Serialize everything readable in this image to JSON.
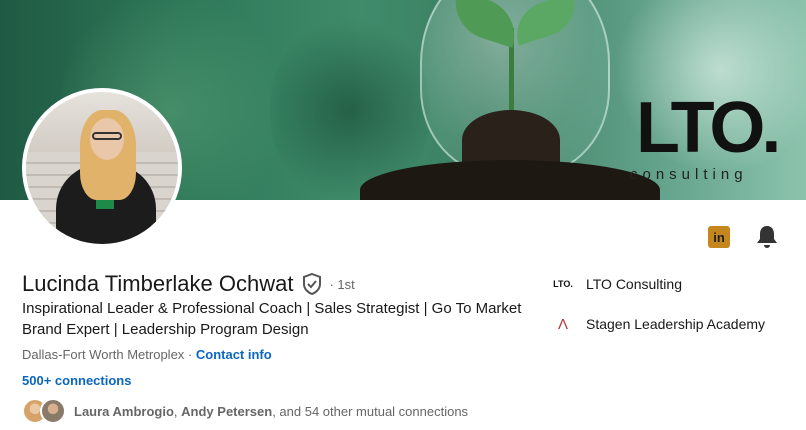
{
  "banner": {
    "brand_big": "LTO.",
    "brand_small": "consulting"
  },
  "profile": {
    "name": "Lucinda Timberlake Ochwat",
    "degree": "· 1st",
    "headline": "Inspirational Leader & Professional Coach | Sales Strategist | Go To Market Brand Expert | Leadership Program Design",
    "location": "Dallas-Fort Worth Metroplex",
    "location_separator": " · ",
    "contact_info": "Contact info",
    "connections": "500+ connections"
  },
  "mutual": {
    "name1": "Laura Ambrogio",
    "sep1": ", ",
    "name2": "Andy Petersen",
    "rest": ", and 54 other mutual connections"
  },
  "actions": {
    "linkedin_icon_glyph": "in",
    "linkedin_color": "#c5861e"
  },
  "companies": [
    {
      "logo_text": "LTO.",
      "name": "LTO Consulting"
    },
    {
      "logo_text": "Λ",
      "name": "Stagen Leadership Academy",
      "logo_color": "#b23a3a"
    }
  ],
  "colors": {
    "link": "#0a66c2",
    "muted": "#666666",
    "text": "#191919"
  },
  "icons": [
    "linkedin-icon",
    "bell-icon",
    "verified-icon"
  ]
}
